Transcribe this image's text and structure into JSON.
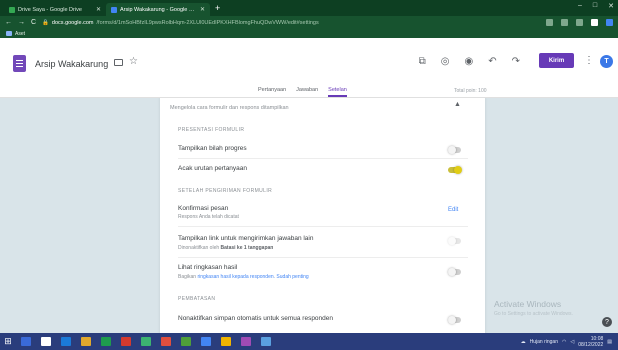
{
  "browser": {
    "tabs": [
      {
        "title": "Drive Saya - Google Drive",
        "active": false
      },
      {
        "title": "Arsip Wakakarung - Google Formulir",
        "active": true
      }
    ],
    "url_domain": "docs.google.com",
    "url_path": "/forms/d/1mSoHBfzIL9pwsRolbHqm-2XLUl0UEdIPKXHFBlomgFhuQDwVWW/edit#settings",
    "bookmarks_label": "Aset"
  },
  "header": {
    "title": "Arsip Wakakarung",
    "tabs": [
      "Pertanyaan",
      "Jawaban",
      "Setelan"
    ],
    "active_tab": "Setelan",
    "save_status": "Total poin: 100",
    "send_label": "Kirim",
    "avatar_letter": "T"
  },
  "settings": {
    "intro": "Mengelola cara formulir dan respons ditampilkan",
    "sections": {
      "form_presentation": "Presentasi Formulir",
      "after_submit": "Setelah pengiriman formulir",
      "restrictions": "Pembatasan"
    },
    "rows": {
      "progress_bar": {
        "label": "Tampilkan bilah progres",
        "on": false
      },
      "shuffle": {
        "label": "Acak urutan pertanyaan",
        "on": true
      },
      "confirmation": {
        "label": "Konfirmasi pesan",
        "sub": "Respons Anda telah dicatat",
        "edit": "Edit"
      },
      "another_response": {
        "label": "Tampilkan link untuk mengirimkan jawaban lain",
        "sub_prefix": "Dinonaktifkan oleh ",
        "sub_bold": "Batasi ke 1 tanggapan",
        "on": false,
        "disabled": true
      },
      "view_results": {
        "label": "Lihat ringkasan hasil",
        "sub_prefix": "Bagikan ",
        "sub_link1": "ringkasan hasil kepada responden",
        "sub_mid": ". ",
        "sub_link2": "Sudah penting",
        "on": false
      },
      "disable_autosave": {
        "label": "Nonaktifkan simpan otomatis untuk semua responden",
        "on": false
      }
    }
  },
  "watermark": {
    "title": "Activate Windows",
    "sub": "Go to Settings to activate Windows."
  },
  "taskbar": {
    "tray_text": "Hujan ringan",
    "time": "10:08",
    "date": "08/12/2022",
    "apps": [
      {
        "color": "#3a6ad8"
      },
      {
        "color": "#ffffff"
      },
      {
        "color": "#1b7ad8"
      },
      {
        "color": "#e0a82e"
      },
      {
        "color": "#1e9b4e"
      },
      {
        "color": "#d33a2f"
      },
      {
        "color": "#3cb371"
      },
      {
        "color": "#e04f3e"
      },
      {
        "color": "#4f9e3a"
      },
      {
        "color": "#4285f4"
      },
      {
        "color": "#f0b400"
      },
      {
        "color": "#a04bb5"
      },
      {
        "color": "#5aa0e0"
      }
    ]
  }
}
